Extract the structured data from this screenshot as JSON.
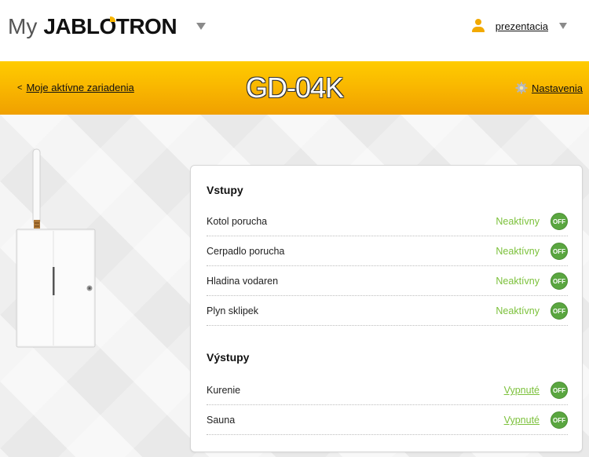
{
  "header": {
    "logo_my": "My",
    "logo_brand_pre": "JABL",
    "logo_brand_o": "O",
    "logo_brand_post": "TRON",
    "user_name": "prezentacia",
    "colors": {
      "accent": "#f7b500",
      "user_icon": "#f2a900"
    }
  },
  "band": {
    "back_chevron": "<",
    "back_label": "Moje aktívne zariadenia",
    "title": "GD-04K",
    "settings_label": "Nastavenia",
    "colors": {
      "top": "#ffcc00",
      "bottom": "#f0a000"
    }
  },
  "panel": {
    "inputs_title": "Vstupy",
    "inputs": [
      {
        "name": "Kotol porucha",
        "status": "Neaktívny",
        "toggle": "OFF"
      },
      {
        "name": "Cerpadlo porucha",
        "status": "Neaktívny",
        "toggle": "OFF"
      },
      {
        "name": "Hladina vodaren",
        "status": "Neaktívny",
        "toggle": "OFF"
      },
      {
        "name": "Plyn sklipek",
        "status": "Neaktívny",
        "toggle": "OFF"
      }
    ],
    "outputs_title": "Výstupy",
    "outputs": [
      {
        "name": "Kurenie",
        "status": "Vypnuté",
        "toggle": "OFF"
      },
      {
        "name": "Sauna",
        "status": "Vypnuté",
        "toggle": "OFF"
      }
    ],
    "colors": {
      "status_green": "#7cc13b",
      "toggle_green": "#5aa640"
    }
  },
  "icons": {
    "user": "user-icon",
    "gear": "gear-icon",
    "dropdown": "chevron-down-icon"
  }
}
